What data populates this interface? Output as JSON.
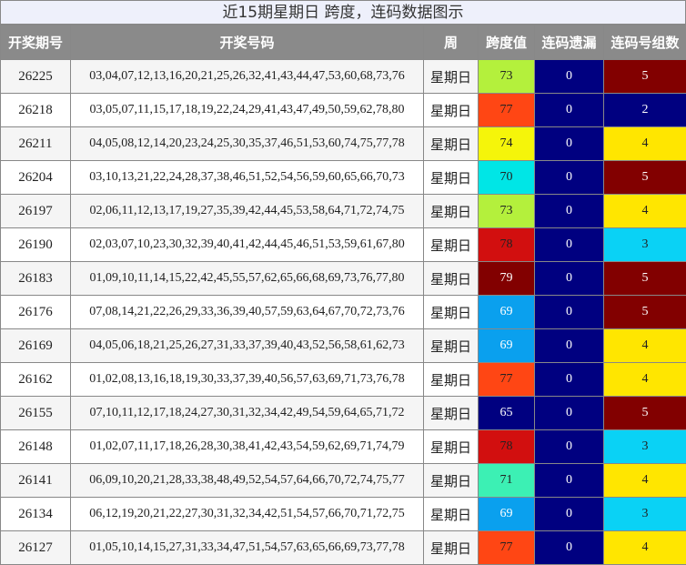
{
  "title": "近15期星期日 跨度，连码数据图示",
  "headers": {
    "issue": "开奖期号",
    "numbers": "开奖号码",
    "week": "周",
    "span": "跨度值",
    "miss": "连码遗漏",
    "groups": "连码号组数"
  },
  "colors": {
    "span": {
      "65": "#000080",
      "69": "#0aa0ee",
      "70": "#00e6e6",
      "71": "#3cf0b4",
      "73": "#b4f03c",
      "74": "#f5f50a",
      "77": "#ff4614",
      "78": "#d20f0f",
      "79": "#820000"
    },
    "groups": {
      "2": "#000080",
      "3": "#0ad2f5",
      "4": "#ffe600",
      "5": "#820000"
    }
  },
  "rows": [
    {
      "issue": "26225",
      "numbers": "03,04,07,12,13,16,20,21,25,26,32,41,43,44,47,53,60,68,73,76",
      "week": "星期日",
      "span": "73",
      "miss": "0",
      "groups": "5"
    },
    {
      "issue": "26218",
      "numbers": "03,05,07,11,15,17,18,19,22,24,29,41,43,47,49,50,59,62,78,80",
      "week": "星期日",
      "span": "77",
      "miss": "0",
      "groups": "2"
    },
    {
      "issue": "26211",
      "numbers": "04,05,08,12,14,20,23,24,25,30,35,37,46,51,53,60,74,75,77,78",
      "week": "星期日",
      "span": "74",
      "miss": "0",
      "groups": "4"
    },
    {
      "issue": "26204",
      "numbers": "03,10,13,21,22,24,28,37,38,46,51,52,54,56,59,60,65,66,70,73",
      "week": "星期日",
      "span": "70",
      "miss": "0",
      "groups": "5"
    },
    {
      "issue": "26197",
      "numbers": "02,06,11,12,13,17,19,27,35,39,42,44,45,53,58,64,71,72,74,75",
      "week": "星期日",
      "span": "73",
      "miss": "0",
      "groups": "4"
    },
    {
      "issue": "26190",
      "numbers": "02,03,07,10,23,30,32,39,40,41,42,44,45,46,51,53,59,61,67,80",
      "week": "星期日",
      "span": "78",
      "miss": "0",
      "groups": "3"
    },
    {
      "issue": "26183",
      "numbers": "01,09,10,11,14,15,22,42,45,55,57,62,65,66,68,69,73,76,77,80",
      "week": "星期日",
      "span": "79",
      "miss": "0",
      "groups": "5"
    },
    {
      "issue": "26176",
      "numbers": "07,08,14,21,22,26,29,33,36,39,40,57,59,63,64,67,70,72,73,76",
      "week": "星期日",
      "span": "69",
      "miss": "0",
      "groups": "5"
    },
    {
      "issue": "26169",
      "numbers": "04,05,06,18,21,25,26,27,31,33,37,39,40,43,52,56,58,61,62,73",
      "week": "星期日",
      "span": "69",
      "miss": "0",
      "groups": "4"
    },
    {
      "issue": "26162",
      "numbers": "01,02,08,13,16,18,19,30,33,37,39,40,56,57,63,69,71,73,76,78",
      "week": "星期日",
      "span": "77",
      "miss": "0",
      "groups": "4"
    },
    {
      "issue": "26155",
      "numbers": "07,10,11,12,17,18,24,27,30,31,32,34,42,49,54,59,64,65,71,72",
      "week": "星期日",
      "span": "65",
      "miss": "0",
      "groups": "5"
    },
    {
      "issue": "26148",
      "numbers": "01,02,07,11,17,18,26,28,30,38,41,42,43,54,59,62,69,71,74,79",
      "week": "星期日",
      "span": "78",
      "miss": "0",
      "groups": "3"
    },
    {
      "issue": "26141",
      "numbers": "06,09,10,20,21,28,33,38,48,49,52,54,57,64,66,70,72,74,75,77",
      "week": "星期日",
      "span": "71",
      "miss": "0",
      "groups": "4"
    },
    {
      "issue": "26134",
      "numbers": "06,12,19,20,21,22,27,30,31,32,34,42,51,54,57,66,70,71,72,75",
      "week": "星期日",
      "span": "69",
      "miss": "0",
      "groups": "3"
    },
    {
      "issue": "26127",
      "numbers": "01,05,10,14,15,27,31,33,34,47,51,54,57,63,65,66,69,73,77,78",
      "week": "星期日",
      "span": "77",
      "miss": "0",
      "groups": "4"
    }
  ]
}
